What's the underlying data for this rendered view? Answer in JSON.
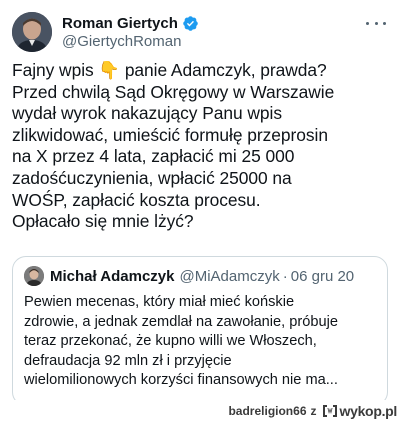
{
  "author": {
    "display_name": "Roman Giertych",
    "handle": "@GiertychRoman",
    "avatar_icon": "profile-photo",
    "verified_icon": "verified-badge-icon",
    "verified_color": "#1d9bf0"
  },
  "tweet": {
    "text": "Fajny wpis 👇 panie Adamczyk, prawda?\nPrzed chwilą Sąd Okręgowy w Warszawie\nwydał wyrok nakazujący Panu wpis\nzlikwidować, umieścić formułę przeprosin\nna X przez 4 lata, zapłacić mi 25 000\nzadośćuczynienia, wpłacić 25000 na\nWOŚP, zapłacić koszta procesu.\nOpłacało się mnie lżyć?"
  },
  "quoted": {
    "display_name": "Michał Adamczyk",
    "handle": "@MiAdamczyk",
    "separator": "·",
    "date": "06 gru 20",
    "text": "Pewien mecenas, który miał mieć końskie\nzdrowie, a jednak zemdlał na zawołanie, próbuje\nteraz przekonać, że kupno willi we Włoszech,\ndefraudacja 92 mln zł i przyjęcie\nwielomilionowych korzyści finansowych nie ma..."
  },
  "footer": {
    "user": "badreligion66",
    "separator": "z",
    "site": "wykop.pl",
    "logo_color": "#3b3b3b"
  }
}
